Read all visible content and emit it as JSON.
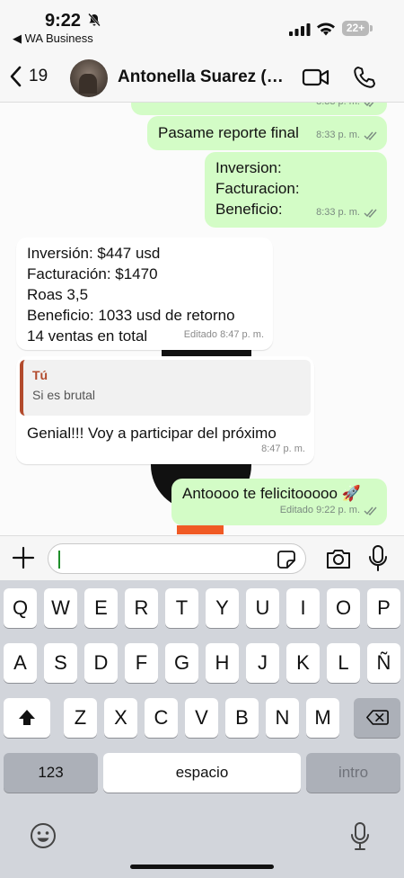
{
  "status_bar": {
    "time": "9:22",
    "back_app": "◀ WA Business",
    "battery": "22+"
  },
  "header": {
    "back_count": "19",
    "contact_name": "Antonella Suarez (La...",
    "icons": [
      "chevron-left-icon",
      "video-call-icon",
      "phone-icon"
    ]
  },
  "chat": {
    "messages": [
      {
        "dir": "out",
        "text": "",
        "time": "8:33 p. m.",
        "read": true
      },
      {
        "dir": "out",
        "text": "Pasame reporte final",
        "time": "8:33 p. m.",
        "read": true
      },
      {
        "dir": "out",
        "lines": [
          "Inversion:",
          "Facturacion:",
          "Beneficio:"
        ],
        "time": "8:33 p. m.",
        "read": true
      },
      {
        "dir": "in",
        "lines": [
          "Inversión: $447 usd",
          "Facturación: $1470",
          "Roas 3,5",
          "Beneficio: 1033 usd de retorno",
          "14 ventas en total"
        ],
        "time": "Editado 8:47 p. m."
      },
      {
        "dir": "in",
        "quote_author": "Tú",
        "quote_text": "Si es brutal",
        "text": "Genial!!! Voy a participar del próximo",
        "time": "8:47 p. m."
      },
      {
        "dir": "out",
        "text": "Antoooo te felicitooooo 🚀",
        "time": "Editado 9:22 p. m.",
        "read": true
      }
    ]
  },
  "input": {
    "value": "",
    "icons": [
      "plus-icon",
      "sticker-icon",
      "camera-icon",
      "microphone-icon"
    ]
  },
  "keyboard": {
    "row1": [
      "Q",
      "W",
      "E",
      "R",
      "T",
      "Y",
      "U",
      "I",
      "O",
      "P"
    ],
    "row2": [
      "A",
      "S",
      "D",
      "F",
      "G",
      "H",
      "J",
      "K",
      "L",
      "Ñ"
    ],
    "row3": [
      "Z",
      "X",
      "C",
      "V",
      "B",
      "N",
      "M"
    ],
    "numbers_key": "123",
    "space_key": "espacio",
    "return_key": "intro",
    "icons": [
      "shift-icon",
      "backspace-icon",
      "emoji-icon",
      "dictation-icon"
    ]
  },
  "colors": {
    "outgoing_bubble": "#d3fcc6",
    "incoming_bubble": "#ffffff",
    "quote_accent": "#b24a2c",
    "read_ticks": "#53bdeb"
  }
}
